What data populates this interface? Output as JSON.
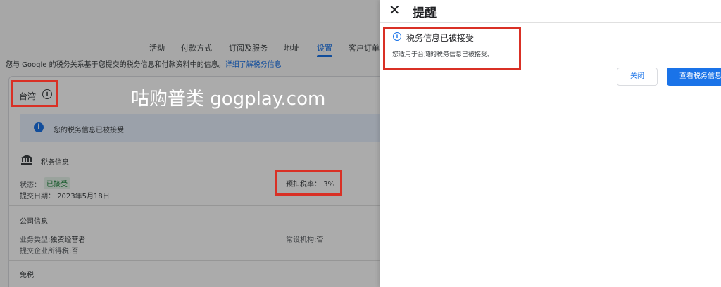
{
  "tabs": [
    "活动",
    "付款方式",
    "订阅及服务",
    "地址",
    "设置",
    "客户订单"
  ],
  "active_tab_index": 4,
  "intro": {
    "text": "您与 Google 的税务关系基于您提交的税务信息和付款资料中的信息。",
    "link": "详细了解税务信息"
  },
  "country": {
    "label": "台湾",
    "icon": "info-icon"
  },
  "watermark": "咕购普类 gogplay.com",
  "notice": {
    "text": "您的税务信息已被接受",
    "icon": "info-filled-icon"
  },
  "tax_info": {
    "icon": "bank-icon",
    "title": "税务信息",
    "status_label": "状态：",
    "status_value": "已接受",
    "submit_date": "提交日期： 2023年5月18日",
    "withholding_rate": "预扣税率： 3%"
  },
  "company": {
    "title": "公司信息",
    "business_type_label": "业务类型:",
    "business_type_value": "独资经营者",
    "pe_label": "常设机构:",
    "pe_value": "否",
    "cit_label": "提交企业所得税:",
    "cit_value": "否"
  },
  "exemption_title": "免税",
  "drawer": {
    "title": "提醒",
    "close_icon": "close-icon",
    "alert_title": "税务信息已被接受",
    "alert_body": "您适用于台湾的税务信息已被接受。",
    "close_button": "关闭",
    "view_button": "查看税务信息"
  },
  "colors": {
    "accent": "#1a73e8",
    "highlight": "#d93025",
    "success": "#188038"
  }
}
